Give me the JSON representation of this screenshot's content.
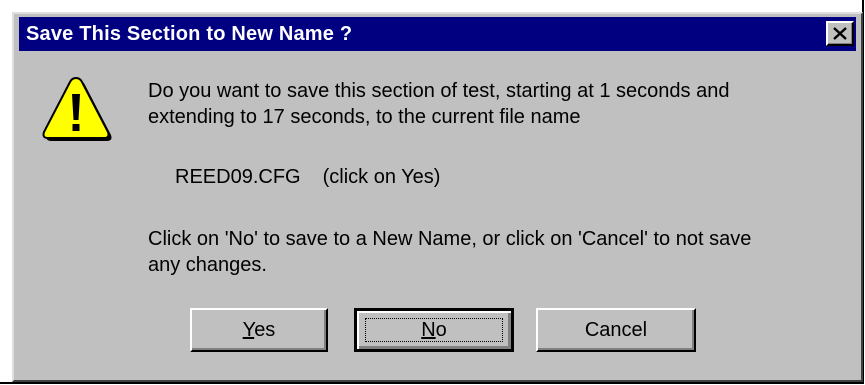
{
  "dialog": {
    "title": "Save This Section to New Name ?",
    "close_icon": "close-icon",
    "warning_icon": "warning-icon",
    "message_line1": "Do you want to save this section of test, starting at 1 seconds and",
    "message_line2": "extending to 17 seconds, to the current file name",
    "filename": "REED09.CFG",
    "filename_hint": "(click on Yes)",
    "message2_line1": "Click on 'No' to save to a New Name, or click on 'Cancel' to not save",
    "message2_line2": "any changes.",
    "buttons": {
      "yes_access": "Y",
      "yes_rest": "es",
      "no_access": "N",
      "no_rest": "o",
      "cancel": "Cancel"
    },
    "colors": {
      "titlebar": "#000080",
      "face": "#c0c0c0",
      "warning_fill": "#ffff00"
    }
  }
}
